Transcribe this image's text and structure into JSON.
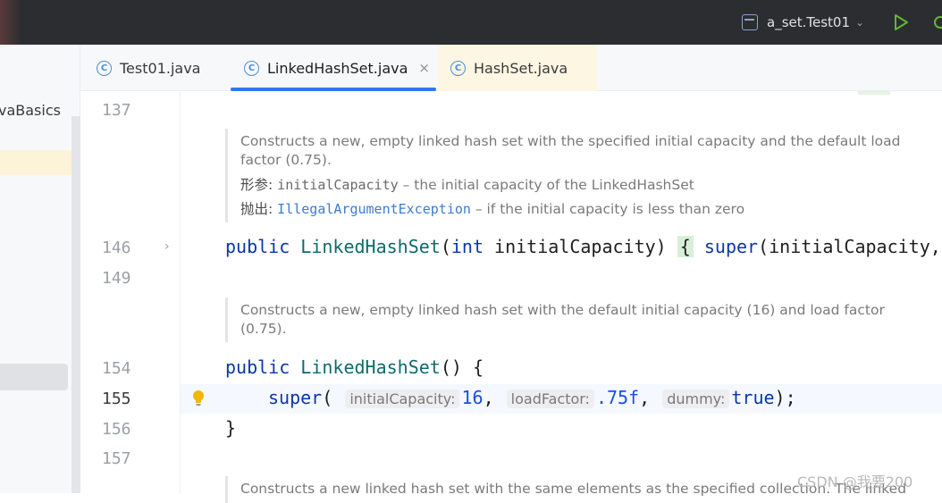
{
  "toolbar": {
    "run_config_label": "a_set.Test01",
    "run_config_chevron": "⌄"
  },
  "sidebar": {
    "project_label": "vaBasics"
  },
  "tabs": [
    {
      "label": "Test01.java",
      "icon": "class-icon",
      "active": false
    },
    {
      "label": "LinkedHashSet.java",
      "icon": "class-icon",
      "active": true,
      "close": "×"
    },
    {
      "label": "HashSet.java",
      "icon": "class-icon",
      "active": false
    }
  ],
  "gutter": {
    "lines": [
      "137",
      "146",
      "149",
      "154",
      "155",
      "156",
      "157"
    ],
    "fold_chevron": "›"
  },
  "editor": {
    "doc1": {
      "text": "Constructs a new, empty linked hash set with the specified initial capacity and the default load factor (0.75).",
      "param_label": "形参:",
      "param_name": "initialCapacity",
      "param_desc": " – the initial capacity of the LinkedHashSet",
      "throws_label": "抛出:",
      "throws_name": "IllegalArgumentException",
      "throws_desc": " – if the initial capacity is less than zero"
    },
    "line146": {
      "kw_public": "public",
      "ctor": "LinkedHashSet",
      "open": "(",
      "kw_int": "int",
      "param": " initialCapacity",
      "close": ")",
      "brace": "{",
      "kw_super": "super",
      "rest": "(initialCapacity,"
    },
    "doc2": {
      "text": "Constructs a new, empty linked hash set with the default initial capacity (16) and load factor (0.75)."
    },
    "line154": {
      "kw_public": "public",
      "ctor": "LinkedHashSet",
      "rest": "() {"
    },
    "line155": {
      "kw_super": "super",
      "open": "(",
      "hint1": "initialCapacity:",
      "val1": "16",
      "sep1": ",",
      "hint2": "loadFactor:",
      "val2": ".75f",
      "sep2": ",",
      "hint3": "dummy:",
      "val3": "true",
      "close": ");"
    },
    "line156": {
      "text": "}"
    },
    "doc3": {
      "text": "Constructs a new linked hash set with the same elements as the specified collection. The linked"
    }
  },
  "watermark": "CSDN @我要200",
  "colors": {
    "accent": "#3574f0",
    "keyword": "#0a38a8",
    "function": "#0e6b6b",
    "number": "#1750eb",
    "run_green": "#5fb832"
  }
}
